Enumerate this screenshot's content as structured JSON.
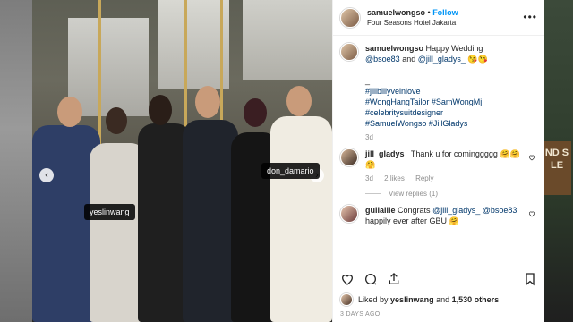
{
  "post": {
    "username": "samuelwongso",
    "follow_label": "Follow",
    "location": "Four Seasons Hotel Jakarta",
    "more_label": "•••"
  },
  "photo": {
    "tags": [
      "yeslinwang",
      "don_damario"
    ],
    "prev_arrow": "‹",
    "next_arrow": "›"
  },
  "caption": {
    "username": "samuelwongso",
    "text_1": "Happy Wedding",
    "mention_1": "@bsoe83",
    "and": "and",
    "mention_2": "@jill_gladys_",
    "emoji": "😘😘",
    "dot": ".",
    "dash": "_",
    "hashtags": [
      "#jillbillyveinlove",
      "#WongHangTailor",
      "#SamWongMj",
      "#celebritysuitdesigner",
      "#SamuelWongso",
      "#JillGladys"
    ],
    "time": "3d"
  },
  "comments": [
    {
      "username": "jill_gladys_",
      "text": "Thank u for cominggggg",
      "emoji": "🤗🤗🤗",
      "time": "3d",
      "likes": "2 likes",
      "reply": "Reply",
      "view_replies": "View replies (1)"
    },
    {
      "username": "gullallie",
      "text_1": "Congrats",
      "mention_1": "@jill_gladys_",
      "mention_2": "@bsoe83",
      "text_2": "happily ever after GBU",
      "emoji": "🤗"
    }
  ],
  "likes": {
    "prefix": "Liked by",
    "user": "yeslinwang",
    "and": "and",
    "count": "1,530 others"
  },
  "date": "3 DAYS AGO",
  "background": {
    "sign_text": "ND S LE"
  },
  "colors": {
    "link_blue": "#0095f6",
    "mention": "#00376b",
    "muted": "#8e8e8e"
  }
}
